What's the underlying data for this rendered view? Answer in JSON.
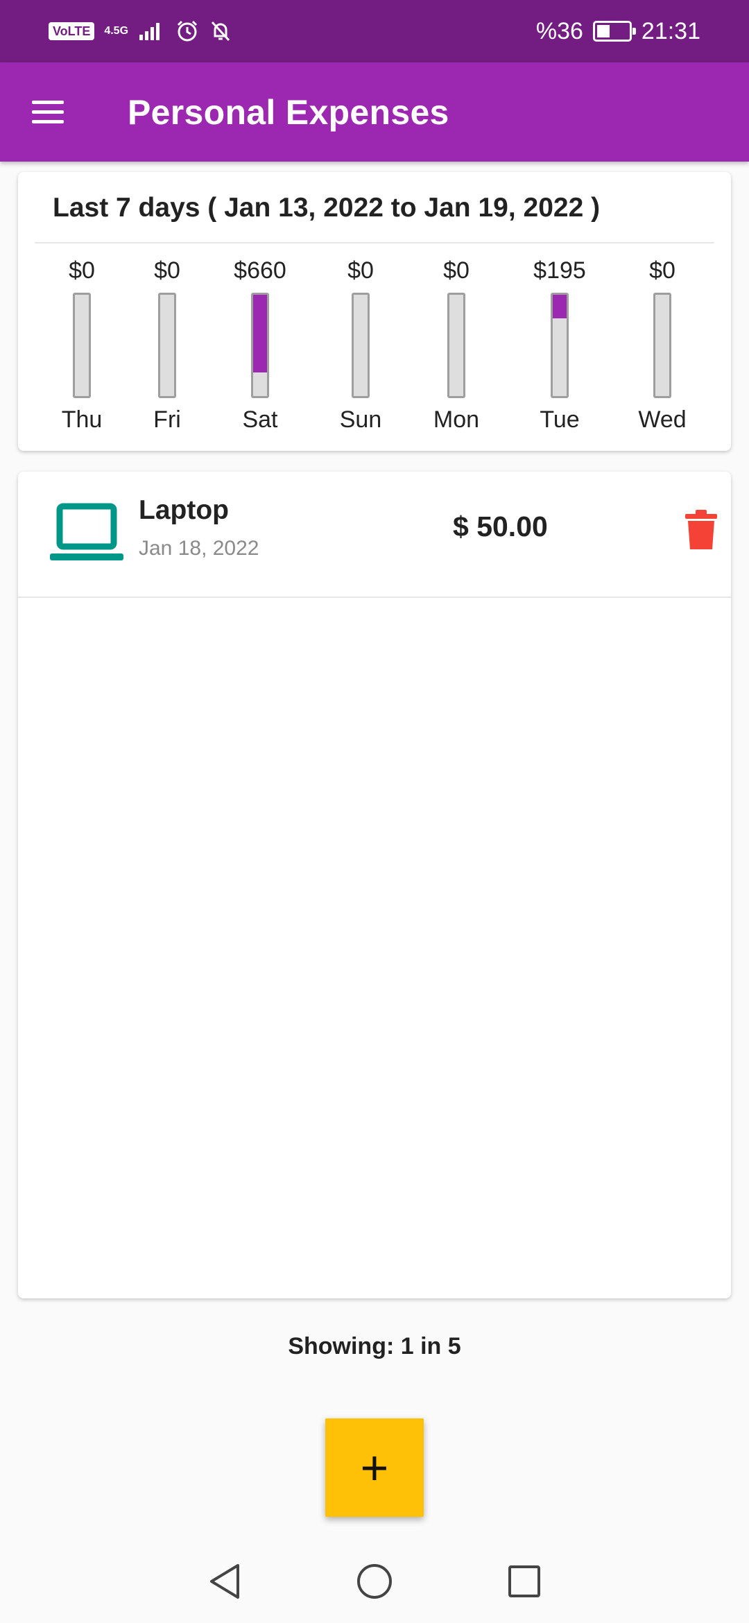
{
  "status_bar": {
    "volte": "VoLTE",
    "network": "4.5G",
    "battery_percent": "%36",
    "time": "21:31",
    "icons": [
      "signal-icon",
      "alarm-icon",
      "bell-off-icon",
      "battery-charging-icon"
    ]
  },
  "app_bar": {
    "title": "Personal Expenses",
    "menu_icon": "menu-icon"
  },
  "chart": {
    "title": "Last 7 days ( Jan 13, 2022 to Jan 19, 2022 )",
    "accent_color": "#9c27b0",
    "days": [
      {
        "label": "Thu",
        "amount": "$0",
        "fill": 0
      },
      {
        "label": "Fri",
        "amount": "$0",
        "fill": 0
      },
      {
        "label": "Sat",
        "amount": "$660",
        "fill": 0.77
      },
      {
        "label": "Sun",
        "amount": "$0",
        "fill": 0
      },
      {
        "label": "Mon",
        "amount": "$0",
        "fill": 0
      },
      {
        "label": "Tue",
        "amount": "$195",
        "fill": 0.23
      },
      {
        "label": "Wed",
        "amount": "$0",
        "fill": 0
      }
    ]
  },
  "expenses": [
    {
      "title": "Laptop",
      "date": "Jan 18, 2022",
      "amount": "$ 50.00",
      "icon": "laptop-icon",
      "icon_color": "#009688",
      "delete_icon": "trash-icon",
      "delete_color": "#f44336"
    }
  ],
  "footer": {
    "showing_text": "Showing: 1 in 5",
    "fab_label": "+",
    "fab_color": "#ffc107"
  },
  "nav_bar": {
    "icons": [
      "back-icon",
      "home-icon",
      "recents-icon"
    ]
  }
}
